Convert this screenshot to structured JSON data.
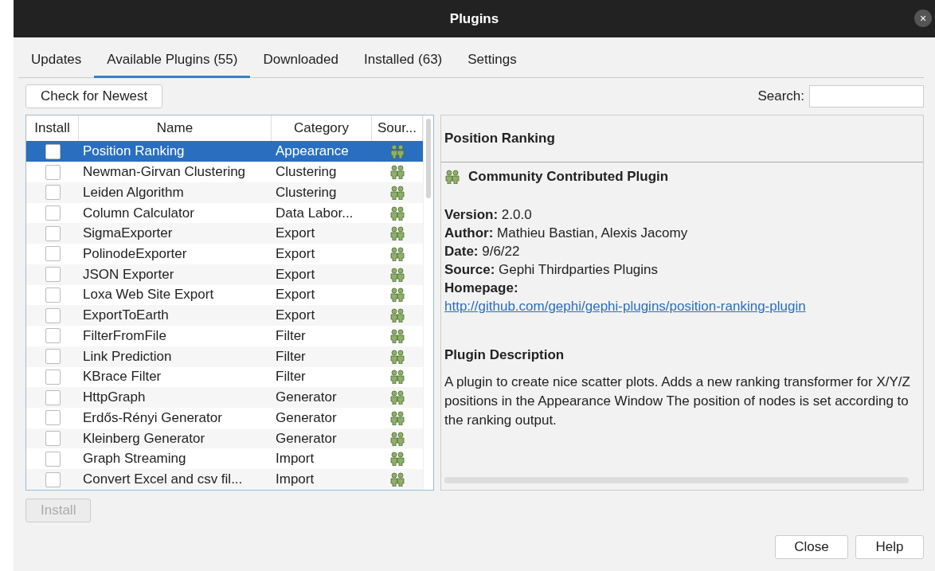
{
  "window": {
    "title": "Plugins",
    "close": "×"
  },
  "tabs": [
    {
      "label": "Updates",
      "selected": false
    },
    {
      "label": "Available Plugins (55)",
      "selected": true
    },
    {
      "label": "Downloaded",
      "selected": false
    },
    {
      "label": "Installed (63)",
      "selected": false
    },
    {
      "label": "Settings",
      "selected": false
    }
  ],
  "toolbar": {
    "button": "Check for Newest",
    "search_label": "Search:"
  },
  "table": {
    "columns": [
      "Install",
      "Name",
      "Category",
      "Sour..."
    ],
    "rows": [
      {
        "name": "Position Ranking",
        "category": "Appearance",
        "checked": false,
        "selected": true
      },
      {
        "name": "Newman-Girvan Clustering",
        "category": "Clustering",
        "checked": false,
        "selected": false
      },
      {
        "name": "Leiden Algorithm",
        "category": "Clustering",
        "checked": false,
        "selected": false
      },
      {
        "name": "Column Calculator",
        "category": "Data Labor...",
        "checked": false,
        "selected": false
      },
      {
        "name": "SigmaExporter",
        "category": "Export",
        "checked": false,
        "selected": false
      },
      {
        "name": "PolinodeExporter",
        "category": "Export",
        "checked": false,
        "selected": false
      },
      {
        "name": "JSON Exporter",
        "category": "Export",
        "checked": false,
        "selected": false
      },
      {
        "name": "Loxa Web Site Export",
        "category": "Export",
        "checked": false,
        "selected": false
      },
      {
        "name": "ExportToEarth",
        "category": "Export",
        "checked": false,
        "selected": false
      },
      {
        "name": "FilterFromFile",
        "category": "Filter",
        "checked": false,
        "selected": false
      },
      {
        "name": "Link Prediction",
        "category": "Filter",
        "checked": false,
        "selected": false
      },
      {
        "name": "KBrace Filter",
        "category": "Filter",
        "checked": false,
        "selected": false
      },
      {
        "name": "HttpGraph",
        "category": "Generator",
        "checked": false,
        "selected": false
      },
      {
        "name": "Erdős-Rényi Generator",
        "category": "Generator",
        "checked": false,
        "selected": false
      },
      {
        "name": "Kleinberg Generator",
        "category": "Generator",
        "checked": false,
        "selected": false
      },
      {
        "name": "Graph Streaming",
        "category": "Import",
        "checked": false,
        "selected": false
      },
      {
        "name": "Convert Excel and csv fil...",
        "category": "Import",
        "checked": false,
        "selected": false
      }
    ]
  },
  "details": {
    "title": "Position Ranking",
    "badge": "Community Contributed Plugin",
    "fields": [
      "**Version:** 2.0.0",
      "**Author:** Mathieu Bastian, Alexis Jacomy",
      "**Date:** 9/6/22",
      "**Source:** Gephi Thirdparties Plugins",
      "**Homepage:**"
    ],
    "link": "http://github.com/gephi/gephi-plugins/position-ranking-plugin",
    "description_title": "Plugin Description",
    "description": "A plugin to create nice scatter plots. Adds a new ranking transformer for X/Y/Z positions in the Appearance Window The position of nodes is set according to the ranking output."
  },
  "install_button": {
    "label": "Install",
    "disabled": true
  },
  "buttons": [
    "Close",
    "Help"
  ]
}
